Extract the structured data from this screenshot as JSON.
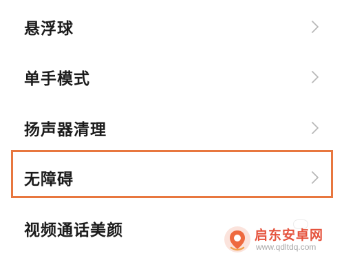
{
  "settings": {
    "items": [
      {
        "label": "悬浮球"
      },
      {
        "label": "单手模式"
      },
      {
        "label": "扬声器清理"
      },
      {
        "label": "无障碍"
      },
      {
        "label": "视频通话美颜"
      }
    ],
    "highlighted_item": "无障碍"
  },
  "watermark": {
    "title": "启东安卓网",
    "url": "www.qdltdq.com"
  },
  "colors": {
    "highlight": "#e8773f",
    "watermark": "#e5533d",
    "text": "#1c1c1c",
    "chevron": "#b8b8b8"
  },
  "icons": {
    "chevron": "chevron-right-icon",
    "watermark_logo": "location-pin-logo"
  }
}
